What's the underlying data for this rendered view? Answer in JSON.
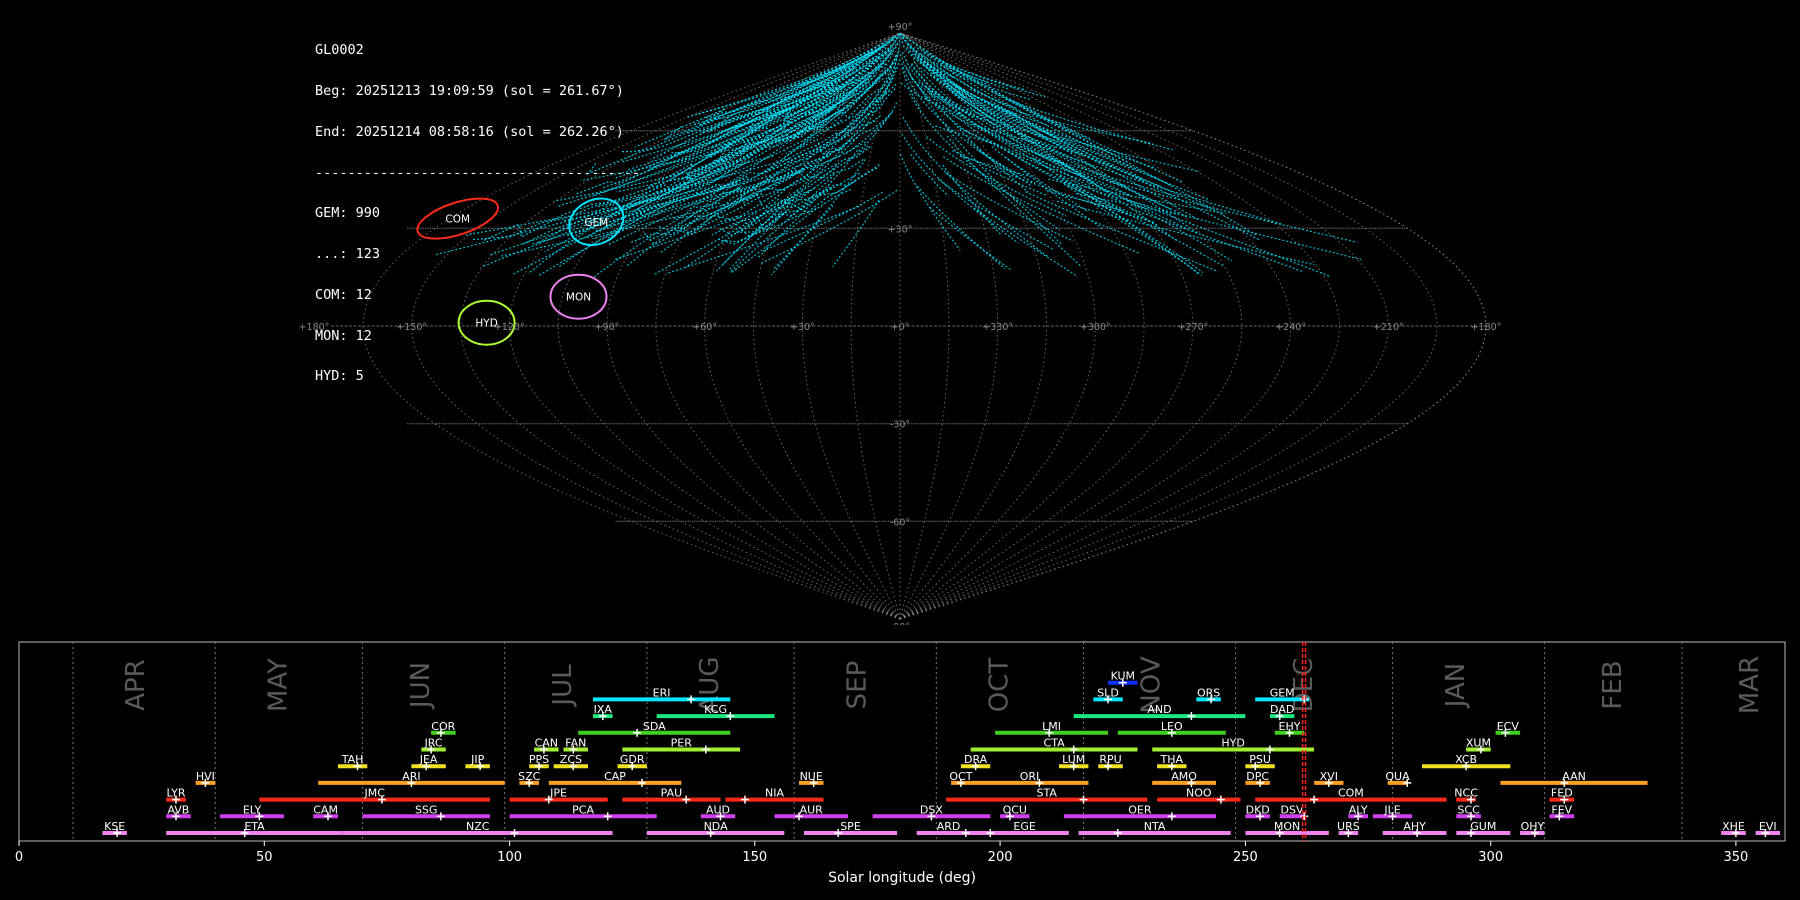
{
  "info": {
    "id": "GL0002",
    "begin": "Beg: 20251213 19:09:59 (sol = 261.67°)",
    "end": "End: 20251214 08:58:16 (sol = 262.26°)",
    "separator": "----------------------------------------",
    "counts": [
      "GEM: 990",
      "...: 123",
      "COM: 12",
      "MON: 12",
      "HYD: 5"
    ]
  },
  "colors": {
    "background": "#000000",
    "tracks": "#00e5ff",
    "grid": "#8a8a8a",
    "sol_marker": "#ff2020"
  },
  "chart_data": [
    {
      "type": "scatter",
      "projection": "sinusoidal (equal-area) sky map",
      "grid": true,
      "lat_ticks": [
        "+90°",
        "+30°",
        "-30°",
        "-60°",
        "-90°"
      ],
      "lon_ticks": [
        "+180°",
        "+150°",
        "+120°",
        "+90°",
        "+60°",
        "+30°",
        "+0°",
        "+330°",
        "+300°",
        "+270°",
        "+240°",
        "+210°",
        "+180°"
      ],
      "radiants": [
        {
          "name": "GEM",
          "lon": 110,
          "lat": 32,
          "color": "#00e5ff"
        },
        {
          "name": "COM",
          "lon": 162,
          "lat": 33,
          "color": "#ff2a1a"
        },
        {
          "name": "MON",
          "lon": 100,
          "lat": 9,
          "color": "#ee82ee"
        },
        {
          "name": "HYD",
          "lon": 127,
          "lat": 1,
          "color": "#adff2f"
        }
      ]
    },
    {
      "type": "bar",
      "xlabel": "Solar longitude (deg)",
      "xlim": [
        0,
        360
      ],
      "xticks": [
        0,
        50,
        100,
        150,
        200,
        250,
        300,
        350
      ],
      "current_sol": [
        261.67,
        262.26
      ],
      "months": [
        {
          "name": "APR",
          "start": 11,
          "label": 24
        },
        {
          "name": "MAY",
          "start": 40,
          "label": 53
        },
        {
          "name": "JUN",
          "start": 70,
          "label": 82
        },
        {
          "name": "JUL",
          "start": 99,
          "label": 111
        },
        {
          "name": "AUG",
          "start": 128,
          "label": 141
        },
        {
          "name": "SEP",
          "start": 158,
          "label": 171
        },
        {
          "name": "OCT",
          "start": 187,
          "label": 200
        },
        {
          "name": "NOV",
          "start": 217,
          "label": 231
        },
        {
          "name": "DEC",
          "start": 248,
          "label": 262
        },
        {
          "name": "JAN",
          "start": 280,
          "label": 293
        },
        {
          "name": "FEB",
          "start": 311,
          "label": 325
        },
        {
          "name": "MAR",
          "start": 339,
          "label": 353
        }
      ],
      "showers": [
        {
          "code": "KUM",
          "start": 222,
          "end": 228,
          "peak": 225,
          "row": 10,
          "color": "#1030ff"
        },
        {
          "code": "ERI",
          "start": 117,
          "end": 145,
          "peak": 137,
          "row": 9,
          "color": "#00e5ff"
        },
        {
          "code": "SLD",
          "start": 219,
          "end": 225,
          "peak": 222,
          "row": 9,
          "color": "#00e5ff"
        },
        {
          "code": "ORS",
          "start": 240,
          "end": 245,
          "peak": 243,
          "row": 9,
          "color": "#00e5ff"
        },
        {
          "code": "GEM",
          "start": 252,
          "end": 263,
          "peak": 262,
          "row": 9,
          "color": "#00e5ff"
        },
        {
          "code": "IXA",
          "start": 117,
          "end": 121,
          "peak": 119,
          "row": 8,
          "color": "#20e880"
        },
        {
          "code": "KCG",
          "start": 130,
          "end": 154,
          "peak": 145,
          "row": 8,
          "color": "#20e880"
        },
        {
          "code": "AND",
          "start": 215,
          "end": 250,
          "peak": 239,
          "row": 8,
          "color": "#20e880"
        },
        {
          "code": "DAD",
          "start": 255,
          "end": 260,
          "peak": 257,
          "row": 8,
          "color": "#20e880"
        },
        {
          "code": "COR",
          "start": 84,
          "end": 89,
          "peak": 86,
          "row": 7,
          "color": "#40d020"
        },
        {
          "code": "SDA",
          "start": 114,
          "end": 145,
          "peak": 126,
          "row": 7,
          "color": "#40d020"
        },
        {
          "code": "LMI",
          "start": 199,
          "end": 222,
          "peak": 210,
          "row": 7,
          "color": "#40d020"
        },
        {
          "code": "LEO",
          "start": 224,
          "end": 246,
          "peak": 235,
          "row": 7,
          "color": "#40d020"
        },
        {
          "code": "EHY",
          "start": 256,
          "end": 262,
          "peak": 259,
          "row": 7,
          "color": "#40d020"
        },
        {
          "code": "ECV",
          "start": 301,
          "end": 306,
          "peak": 303,
          "row": 7,
          "color": "#40d020"
        },
        {
          "code": "JRC",
          "start": 82,
          "end": 87,
          "peak": 84,
          "row": 6,
          "color": "#a0ee30"
        },
        {
          "code": "CAN",
          "start": 105,
          "end": 110,
          "peak": 107,
          "row": 6,
          "color": "#a0ee30"
        },
        {
          "code": "FAN",
          "start": 111,
          "end": 116,
          "peak": 113,
          "row": 6,
          "color": "#a0ee30"
        },
        {
          "code": "PER",
          "start": 123,
          "end": 147,
          "peak": 140,
          "row": 6,
          "color": "#a0ee30"
        },
        {
          "code": "CTA",
          "start": 194,
          "end": 228,
          "peak": 215,
          "row": 6,
          "color": "#a0ee30"
        },
        {
          "code": "HYD",
          "start": 231,
          "end": 264,
          "peak": 255,
          "row": 6,
          "color": "#a0ee30"
        },
        {
          "code": "XUM",
          "start": 295,
          "end": 300,
          "peak": 298,
          "row": 6,
          "color": "#a0ee30"
        },
        {
          "code": "TAH",
          "start": 65,
          "end": 71,
          "peak": 69,
          "row": 5,
          "color": "#f0e020"
        },
        {
          "code": "JEA",
          "start": 80,
          "end": 87,
          "peak": 83,
          "row": 5,
          "color": "#f0e020"
        },
        {
          "code": "JIP",
          "start": 91,
          "end": 96,
          "peak": 94,
          "row": 5,
          "color": "#f0e020"
        },
        {
          "code": "PPS",
          "start": 104,
          "end": 108,
          "peak": 106,
          "row": 5,
          "color": "#f0e020"
        },
        {
          "code": "ZCS",
          "start": 109,
          "end": 116,
          "peak": 113,
          "row": 5,
          "color": "#f0e020"
        },
        {
          "code": "GDR",
          "start": 122,
          "end": 128,
          "peak": 125,
          "row": 5,
          "color": "#f0e020"
        },
        {
          "code": "DRA",
          "start": 192,
          "end": 198,
          "peak": 195,
          "row": 5,
          "color": "#f0e020"
        },
        {
          "code": "LUM",
          "start": 212,
          "end": 218,
          "peak": 215,
          "row": 5,
          "color": "#f0e020"
        },
        {
          "code": "RPU",
          "start": 220,
          "end": 225,
          "peak": 222,
          "row": 5,
          "color": "#f0e020"
        },
        {
          "code": "THA",
          "start": 232,
          "end": 238,
          "peak": 235,
          "row": 5,
          "color": "#f0e020"
        },
        {
          "code": "PSU",
          "start": 250,
          "end": 256,
          "peak": 252,
          "row": 5,
          "color": "#f0e020"
        },
        {
          "code": "XCB",
          "start": 286,
          "end": 304,
          "peak": 295,
          "row": 5,
          "color": "#f0e020"
        },
        {
          "code": "HVI",
          "start": 36,
          "end": 40,
          "peak": 38,
          "row": 4,
          "color": "#ffa020"
        },
        {
          "code": "ARI",
          "start": 61,
          "end": 99,
          "peak": 80,
          "row": 4,
          "color": "#ffa020"
        },
        {
          "code": "SZC",
          "start": 102,
          "end": 106,
          "peak": 104,
          "row": 4,
          "color": "#ffa020"
        },
        {
          "code": "CAP",
          "start": 108,
          "end": 135,
          "peak": 127,
          "row": 4,
          "color": "#ffa020"
        },
        {
          "code": "NUE",
          "start": 159,
          "end": 164,
          "peak": 162,
          "row": 4,
          "color": "#ffa020"
        },
        {
          "code": "OCT",
          "start": 190,
          "end": 194,
          "peak": 192,
          "row": 4,
          "color": "#ffa020"
        },
        {
          "code": "ORI",
          "start": 194,
          "end": 218,
          "peak": 208,
          "row": 4,
          "color": "#ffa020"
        },
        {
          "code": "AMO",
          "start": 231,
          "end": 244,
          "peak": 239,
          "row": 4,
          "color": "#ffa020"
        },
        {
          "code": "DPC",
          "start": 250,
          "end": 255,
          "peak": 253,
          "row": 4,
          "color": "#ffa020"
        },
        {
          "code": "XVI",
          "start": 264,
          "end": 270,
          "peak": 267,
          "row": 4,
          "color": "#ffa020"
        },
        {
          "code": "QUA",
          "start": 279,
          "end": 283,
          "peak": 283,
          "row": 4,
          "color": "#ffa020"
        },
        {
          "code": "AAN",
          "start": 302,
          "end": 332,
          "peak": 315,
          "row": 4,
          "color": "#ffa020"
        },
        {
          "code": "LYR",
          "start": 30,
          "end": 34,
          "peak": 32,
          "row": 3,
          "color": "#ff2a1a"
        },
        {
          "code": "JMC",
          "start": 49,
          "end": 96,
          "peak": 74,
          "row": 3,
          "color": "#ff2a1a"
        },
        {
          "code": "JPE",
          "start": 100,
          "end": 120,
          "peak": 108,
          "row": 3,
          "color": "#ff2a1a"
        },
        {
          "code": "PAU",
          "start": 123,
          "end": 143,
          "peak": 136,
          "row": 3,
          "color": "#ff2a1a"
        },
        {
          "code": "NIA",
          "start": 144,
          "end": 164,
          "peak": 148,
          "row": 3,
          "color": "#ff2a1a"
        },
        {
          "code": "STA",
          "start": 189,
          "end": 230,
          "peak": 217,
          "row": 3,
          "color": "#ff2a1a"
        },
        {
          "code": "NOO",
          "start": 232,
          "end": 249,
          "peak": 245,
          "row": 3,
          "color": "#ff2a1a"
        },
        {
          "code": "COM",
          "start": 252,
          "end": 291,
          "peak": 264,
          "row": 3,
          "color": "#ff2a1a"
        },
        {
          "code": "NCC",
          "start": 293,
          "end": 297,
          "peak": 296,
          "row": 3,
          "color": "#ff2a1a"
        },
        {
          "code": "FED",
          "start": 312,
          "end": 317,
          "peak": 315,
          "row": 3,
          "color": "#ff2a1a"
        },
        {
          "code": "AVB",
          "start": 30,
          "end": 35,
          "peak": 32,
          "row": 2,
          "color": "#d040f0"
        },
        {
          "code": "ELY",
          "start": 41,
          "end": 54,
          "peak": 49,
          "row": 2,
          "color": "#d040f0"
        },
        {
          "code": "CAM",
          "start": 60,
          "end": 65,
          "peak": 63,
          "row": 2,
          "color": "#d040f0"
        },
        {
          "code": "SSG",
          "start": 70,
          "end": 96,
          "peak": 86,
          "row": 2,
          "color": "#d040f0"
        },
        {
          "code": "PCA",
          "start": 100,
          "end": 130,
          "peak": 120,
          "row": 2,
          "color": "#d040f0"
        },
        {
          "code": "AUD",
          "start": 139,
          "end": 146,
          "peak": 143,
          "row": 2,
          "color": "#d040f0"
        },
        {
          "code": "AUR",
          "start": 154,
          "end": 169,
          "peak": 159,
          "row": 2,
          "color": "#d040f0"
        },
        {
          "code": "DSX",
          "start": 174,
          "end": 198,
          "peak": 186,
          "row": 2,
          "color": "#d040f0"
        },
        {
          "code": "OCU",
          "start": 200,
          "end": 206,
          "peak": 202,
          "row": 2,
          "color": "#d040f0"
        },
        {
          "code": "OER",
          "start": 213,
          "end": 244,
          "peak": 235,
          "row": 2,
          "color": "#d040f0"
        },
        {
          "code": "DKD",
          "start": 250,
          "end": 255,
          "peak": 253,
          "row": 2,
          "color": "#d040f0"
        },
        {
          "code": "DSV",
          "start": 257,
          "end": 262,
          "peak": 262,
          "row": 2,
          "color": "#d040f0"
        },
        {
          "code": "ALY",
          "start": 271,
          "end": 275,
          "peak": 273,
          "row": 2,
          "color": "#d040f0"
        },
        {
          "code": "JLE",
          "start": 276,
          "end": 284,
          "peak": 280,
          "row": 2,
          "color": "#d040f0"
        },
        {
          "code": "SCC",
          "start": 293,
          "end": 298,
          "peak": 296,
          "row": 2,
          "color": "#d040f0"
        },
        {
          "code": "FEV",
          "start": 312,
          "end": 317,
          "peak": 314,
          "row": 2,
          "color": "#d040f0"
        },
        {
          "code": "KSE",
          "start": 17,
          "end": 22,
          "peak": 20,
          "row": 1,
          "color": "#ee82ee"
        },
        {
          "code": "ETA",
          "start": 30,
          "end": 66,
          "peak": 46,
          "row": 1,
          "color": "#ee82ee"
        },
        {
          "code": "NZC",
          "start": 66,
          "end": 121,
          "peak": 101,
          "row": 1,
          "color": "#ee82ee"
        },
        {
          "code": "NDA",
          "start": 128,
          "end": 156,
          "peak": 141,
          "row": 1,
          "color": "#ee82ee"
        },
        {
          "code": "SPE",
          "start": 160,
          "end": 179,
          "peak": 167,
          "row": 1,
          "color": "#ee82ee"
        },
        {
          "code": "ARD",
          "start": 183,
          "end": 196,
          "peak": 193,
          "row": 1,
          "color": "#ee82ee"
        },
        {
          "code": "EGE",
          "start": 196,
          "end": 214,
          "peak": 198,
          "row": 1,
          "color": "#ee82ee"
        },
        {
          "code": "NTA",
          "start": 216,
          "end": 247,
          "peak": 224,
          "row": 1,
          "color": "#ee82ee"
        },
        {
          "code": "MON",
          "start": 250,
          "end": 267,
          "peak": 257,
          "row": 1,
          "color": "#ee82ee"
        },
        {
          "code": "URS",
          "start": 269,
          "end": 273,
          "peak": 271,
          "row": 1,
          "color": "#ee82ee"
        },
        {
          "code": "AHY",
          "start": 278,
          "end": 291,
          "peak": 285,
          "row": 1,
          "color": "#ee82ee"
        },
        {
          "code": "GUM",
          "start": 293,
          "end": 304,
          "peak": 296,
          "row": 1,
          "color": "#ee82ee"
        },
        {
          "code": "OHY",
          "start": 306,
          "end": 311,
          "peak": 309,
          "row": 1,
          "color": "#ee82ee"
        },
        {
          "code": "XHE",
          "start": 347,
          "end": 352,
          "peak": 350,
          "row": 1,
          "color": "#ee82ee"
        },
        {
          "code": "EVI",
          "start": 354,
          "end": 359,
          "peak": 356,
          "row": 1,
          "color": "#ee82ee"
        }
      ]
    }
  ]
}
